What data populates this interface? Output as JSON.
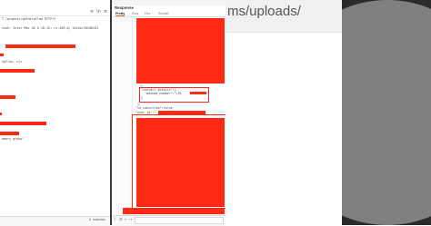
{
  "left_panel": {
    "request_line": "T /graphql/getHelpFlow HTTP/2",
    "user_agent": "tosh; Intel Mac OS X 10.15; rv:109.0) Gecko/20100101",
    "field_fragment": "ipFlow, n/v",
    "code_fragment": "emory_group\"",
    "matches_count": "0",
    "matches_label": "matches"
  },
  "response_panel": {
    "title": "Response",
    "tabs": [
      "Pretty",
      "Raw",
      "Hex",
      "Render"
    ],
    "active_tab": "Pretty",
    "lines": [
      "},",
      "\"contact_details\":{",
      "\"masked_number\":\"+91",
      "}",
      "},",
      "\"is_cancelled\":false,",
      "\"user_id\":\""
    ],
    "search_placeholder": "Search..."
  },
  "browser": {
    "url_fragment": "ms/uploads/"
  },
  "colors": {
    "redaction": "#ff2a14",
    "dark_panel": "#2b2b2b",
    "circle": "#808080"
  }
}
